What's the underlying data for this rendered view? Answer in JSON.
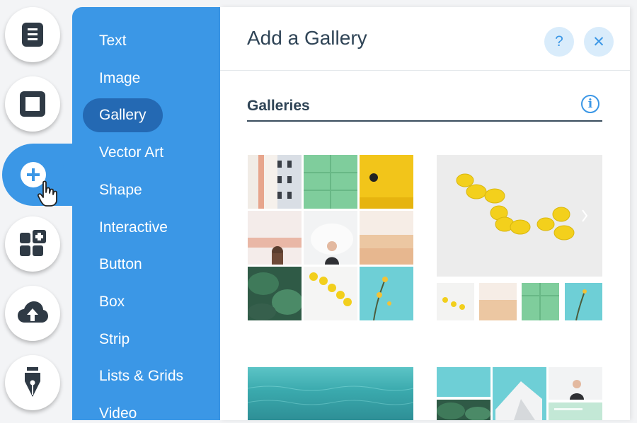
{
  "rail": {
    "items": [
      {
        "name": "pages-icon"
      },
      {
        "name": "background-icon"
      },
      {
        "name": "add-icon",
        "active": true
      },
      {
        "name": "app-market-icon"
      },
      {
        "name": "upload-icon"
      },
      {
        "name": "pen-icon"
      }
    ]
  },
  "menu": {
    "items": [
      "Text",
      "Image",
      "Gallery",
      "Vector Art",
      "Shape",
      "Interactive",
      "Button",
      "Box",
      "Strip",
      "Lists & Grids",
      "Video"
    ],
    "selected": "Gallery"
  },
  "panel": {
    "title": "Add a Gallery",
    "help_label": "?",
    "close_label": "✕",
    "section_title": "Galleries",
    "info_label": "i"
  },
  "colors": {
    "accent": "#3b97e6",
    "selected": "#2469b3",
    "title": "#2f4456"
  }
}
